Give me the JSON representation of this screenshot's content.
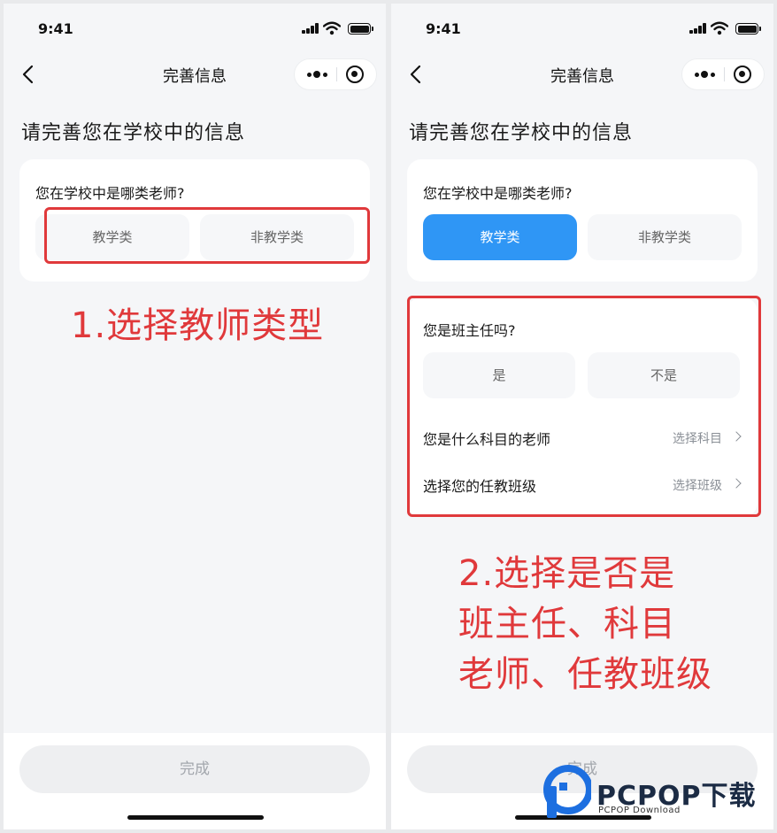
{
  "status_bar": {
    "time": "9:41"
  },
  "nav": {
    "title": "完善信息"
  },
  "page_title": "请完善您在学校中的信息",
  "teacher_type": {
    "question": "您在学校中是哪类老师?",
    "options": [
      "教学类",
      "非教学类"
    ],
    "selected_left": "",
    "selected_right": "教学类"
  },
  "head_teacher": {
    "question": "您是班主任吗?",
    "options": [
      "是",
      "不是"
    ]
  },
  "subject_row": {
    "label": "您是什么科目的老师",
    "value": "选择科目"
  },
  "class_row": {
    "label": "选择您的任教班级",
    "value": "选择班级"
  },
  "footer": {
    "done_label": "完成"
  },
  "annotations": {
    "step1": "1.选择教师类型",
    "step2_lines": [
      "2.选择是否是",
      "班主任、科目",
      "老师、任教班级"
    ],
    "color": "#e0393b"
  },
  "watermark": {
    "brand": "PCPOP下载",
    "sub": "PCPOP Download"
  },
  "colors": {
    "accent": "#2f96f5",
    "annotation_red": "#e0393b",
    "page_bg": "#f5f6f8"
  }
}
